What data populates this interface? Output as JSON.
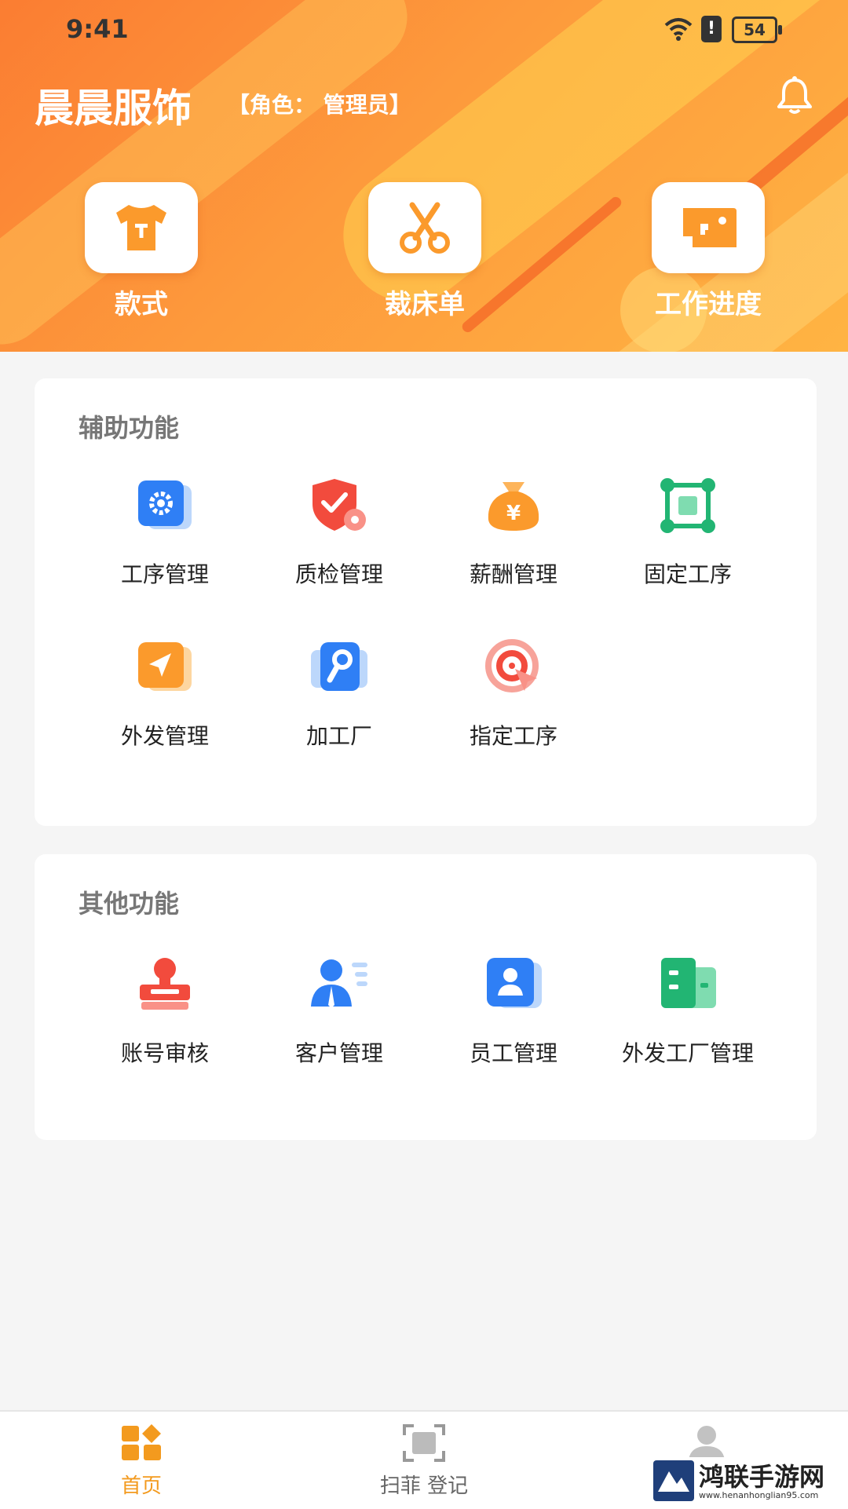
{
  "status_bar": {
    "time": "9:41",
    "battery": "54"
  },
  "header": {
    "title": "晨晨服饰",
    "role": "【角色： 管理员】",
    "shortcuts": [
      {
        "label": "款式",
        "icon": "tshirt-icon"
      },
      {
        "label": "裁床单",
        "icon": "scissors-icon"
      },
      {
        "label": "工作进度",
        "icon": "sewing-machine-icon"
      }
    ]
  },
  "aux_section": {
    "title": "辅助功能",
    "items": [
      {
        "label": "工序管理",
        "icon": "gear-icon"
      },
      {
        "label": "质检管理",
        "icon": "shield-check-icon"
      },
      {
        "label": "薪酬管理",
        "icon": "money-bag-icon"
      },
      {
        "label": "固定工序",
        "icon": "nodes-icon"
      },
      {
        "label": "外发管理",
        "icon": "send-icon"
      },
      {
        "label": "加工厂",
        "icon": "wrench-icon"
      },
      {
        "label": "指定工序",
        "icon": "target-icon"
      }
    ]
  },
  "other_section": {
    "title": "其他功能",
    "items": [
      {
        "label": "账号审核",
        "icon": "stamp-icon"
      },
      {
        "label": "客户管理",
        "icon": "customer-icon"
      },
      {
        "label": "员工管理",
        "icon": "employee-card-icon"
      },
      {
        "label": "外发工厂管理",
        "icon": "factory-icon"
      }
    ]
  },
  "bottom_nav": {
    "items": [
      {
        "label": "首页",
        "icon": "home-grid-icon",
        "active": true
      },
      {
        "label": "扫菲 登记",
        "icon": "scan-icon",
        "active": false
      },
      {
        "label": "",
        "icon": "profile-icon",
        "active": false
      }
    ]
  },
  "watermark": {
    "text": "鸿联手游网",
    "url": "www.henanhonglian95.com"
  },
  "colors": {
    "brand": "#fb8a35",
    "active_nav": "#f39a1e",
    "inactive_nav": "#999999"
  }
}
